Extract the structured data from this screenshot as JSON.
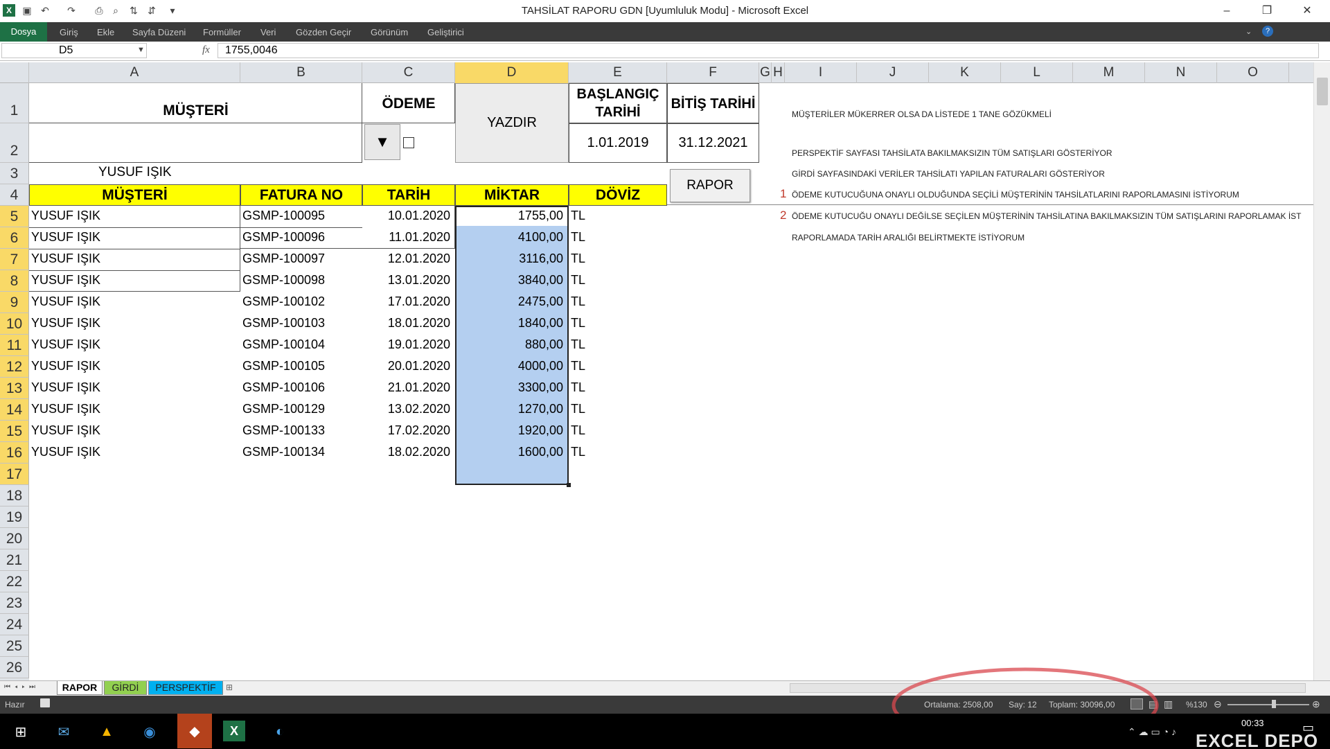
{
  "window": {
    "title": "TAHSİLAT RAPORU GDN  [Uyumluluk Modu]  -  Microsoft Excel",
    "minimize": "–",
    "restore": "❐",
    "close": "✕"
  },
  "ribbon": {
    "tabs": [
      "Dosya",
      "Giriş",
      "Ekle",
      "Sayfa Düzeni",
      "Formüller",
      "Veri",
      "Gözden Geçir",
      "Görünüm",
      "Geliştirici"
    ]
  },
  "formula_bar": {
    "name_box": "D5",
    "fx": "fx",
    "value": "1755,0046"
  },
  "columns": [
    "A",
    "B",
    "C",
    "D",
    "E",
    "F",
    "G",
    "H",
    "I",
    "J",
    "K",
    "L",
    "M",
    "N",
    "O"
  ],
  "rows": [
    "1",
    "2",
    "3",
    "4",
    "5",
    "6",
    "7",
    "8",
    "9",
    "10",
    "11",
    "12",
    "13",
    "14",
    "15",
    "16",
    "17",
    "18",
    "19",
    "20",
    "21",
    "22",
    "23",
    "24",
    "25",
    "26"
  ],
  "sheet": {
    "musteri_label": "MÜŞTERİ",
    "odeme_label": "ÖDEME",
    "yazdir_label": "YAZDIR",
    "baslangic_label": "BAŞLANGIÇ TARİHİ",
    "baslangic_value": "1.01.2019",
    "bitis_label": "BİTİŞ TARİHİ",
    "bitis_value": "31.12.2021",
    "selected_customer": "YUSUF IŞIK",
    "rapor_button": "RAPOR",
    "table_headers": [
      "MÜŞTERİ",
      "FATURA NO",
      "TARİH",
      "MİKTAR",
      "DÖVİZ"
    ],
    "table_rows": [
      {
        "musteri": "YUSUF IŞIK",
        "fatura": "GSMP-100095",
        "tarih": "10.01.2020",
        "miktar": "1755,00",
        "doviz": "TL"
      },
      {
        "musteri": "YUSUF IŞIK",
        "fatura": "GSMP-100096",
        "tarih": "11.01.2020",
        "miktar": "4100,00",
        "doviz": "TL"
      },
      {
        "musteri": "YUSUF IŞIK",
        "fatura": "GSMP-100097",
        "tarih": "12.01.2020",
        "miktar": "3116,00",
        "doviz": "TL"
      },
      {
        "musteri": "YUSUF IŞIK",
        "fatura": "GSMP-100098",
        "tarih": "13.01.2020",
        "miktar": "3840,00",
        "doviz": "TL"
      },
      {
        "musteri": "YUSUF IŞIK",
        "fatura": "GSMP-100102",
        "tarih": "17.01.2020",
        "miktar": "2475,00",
        "doviz": "TL"
      },
      {
        "musteri": "YUSUF IŞIK",
        "fatura": "GSMP-100103",
        "tarih": "18.01.2020",
        "miktar": "1840,00",
        "doviz": "TL"
      },
      {
        "musteri": "YUSUF IŞIK",
        "fatura": "GSMP-100104",
        "tarih": "19.01.2020",
        "miktar": "880,00",
        "doviz": "TL"
      },
      {
        "musteri": "YUSUF IŞIK",
        "fatura": "GSMP-100105",
        "tarih": "20.01.2020",
        "miktar": "4000,00",
        "doviz": "TL"
      },
      {
        "musteri": "YUSUF IŞIK",
        "fatura": "GSMP-100106",
        "tarih": "21.01.2020",
        "miktar": "3300,00",
        "doviz": "TL"
      },
      {
        "musteri": "YUSUF IŞIK",
        "fatura": "GSMP-100129",
        "tarih": "13.02.2020",
        "miktar": "1270,00",
        "doviz": "TL"
      },
      {
        "musteri": "YUSUF IŞIK",
        "fatura": "GSMP-100133",
        "tarih": "17.02.2020",
        "miktar": "1920,00",
        "doviz": "TL"
      },
      {
        "musteri": "YUSUF IŞIK",
        "fatura": "GSMP-100134",
        "tarih": "18.02.2020",
        "miktar": "1600,00",
        "doviz": "TL"
      }
    ],
    "notes": [
      {
        "idx": "",
        "text": "MÜŞTERİLER MÜKERRER OLSA DA LİSTEDE 1 TANE GÖZÜKMELİ"
      },
      {
        "idx": "",
        "text": "PERSPEKTİF SAYFASI TAHSİLATA BAKILMAKSIZIN TÜM SATIŞLARI GÖSTERİYOR"
      },
      {
        "idx": "",
        "text": "GİRDİ SAYFASINDAKİ VERİLER TAHSİLATI YAPILAN FATURALARI GÖSTERİYOR"
      },
      {
        "idx": "1",
        "text": "ÖDEME KUTUCUĞUNA ONAYLI OLDUĞUNDA SEÇİLİ MÜŞTERİNİN TAHSİLATLARINI RAPORLAMASINI İSTİYORUM"
      },
      {
        "idx": "2",
        "text": "ÖDEME KUTUCUĞU ONAYLI DEĞİLSE SEÇİLEN MÜŞTERİNİN TAHSİLATINA BAKILMAKSIZIN TÜM SATIŞLARINI RAPORLAMAK İST"
      },
      {
        "idx": "",
        "text": "RAPORLAMADA TARİH ARALIĞI BELİRTMEKTE İSTİYORUM"
      }
    ]
  },
  "sheet_tabs": [
    {
      "label": "RAPOR",
      "color": "#ffffff"
    },
    {
      "label": "GİRDİ",
      "color": "#92d050"
    },
    {
      "label": "PERSPEKTİF",
      "color": "#00b0f0"
    }
  ],
  "status": {
    "ready": "Hazır",
    "average": "Ortalama: 2508,00",
    "count": "Say: 12",
    "sum": "Toplam: 30096,00",
    "zoom": "%130"
  },
  "taskbar": {
    "clock": "00:33",
    "watermark": "EXCEL DEPO"
  },
  "colors": {
    "accent": "#1e7145",
    "header_fill": "#ffff00",
    "selection": "#b4cff0",
    "annotation": "#d9484f"
  }
}
